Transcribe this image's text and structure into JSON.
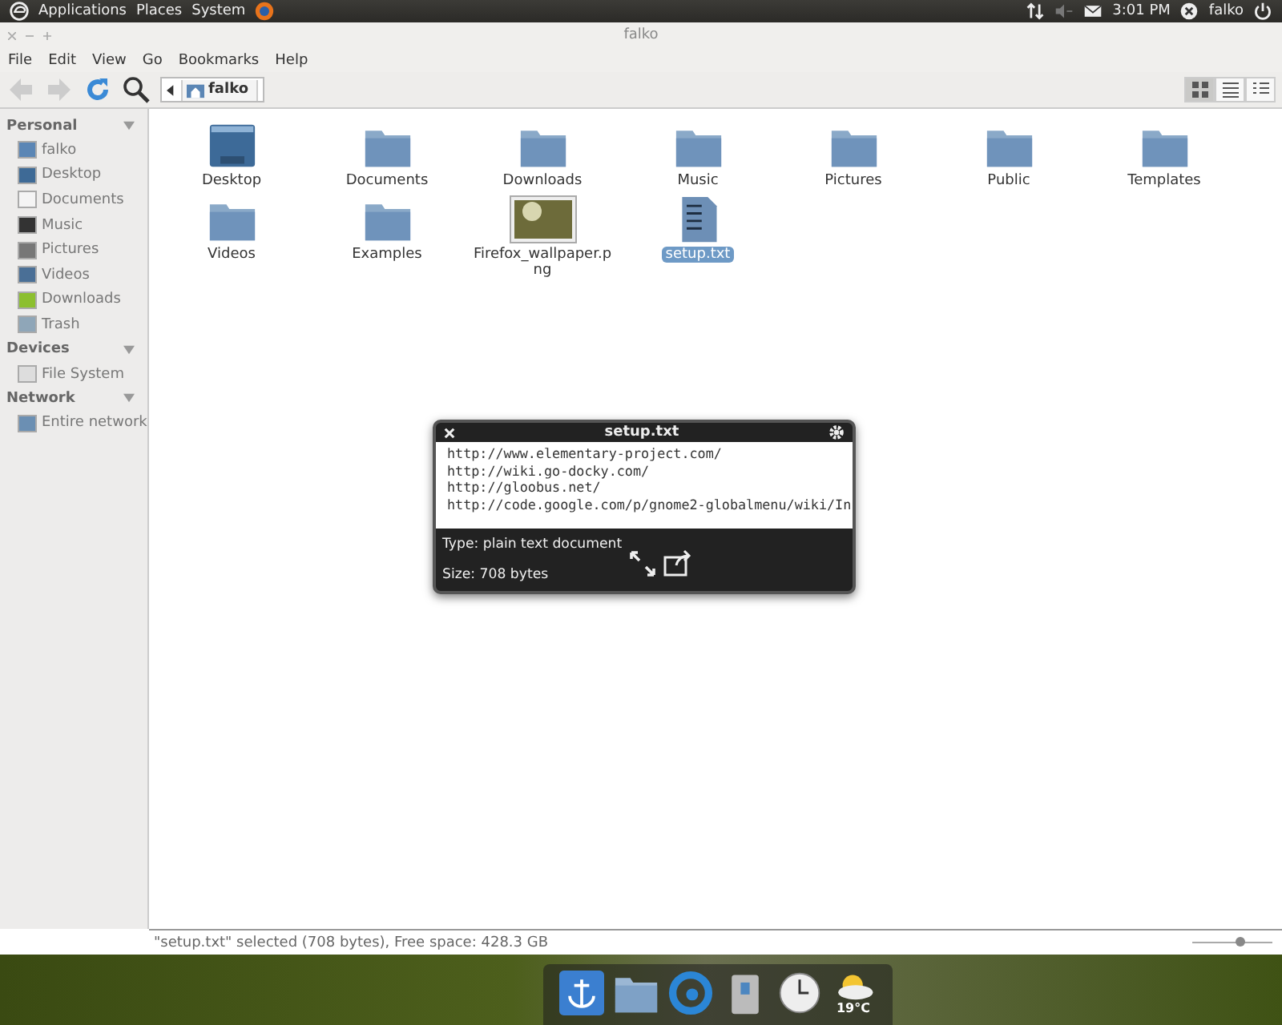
{
  "top_panel": {
    "menus": [
      "Applications",
      "Places",
      "System"
    ],
    "clock": "3:01 PM",
    "user": "falko"
  },
  "window": {
    "title": "falko"
  },
  "menu": [
    "File",
    "Edit",
    "View",
    "Go",
    "Bookmarks",
    "Help"
  ],
  "toolbar": {
    "location": "falko",
    "views": [
      {
        "kind": "icons",
        "selected": true
      },
      {
        "kind": "list",
        "selected": false
      },
      {
        "kind": "compact",
        "selected": false
      }
    ]
  },
  "sidebar": [
    {
      "heading": "Personal",
      "expanded": true,
      "items": [
        {
          "label": "falko",
          "kind": "home"
        },
        {
          "label": "Desktop",
          "kind": "desktop"
        },
        {
          "label": "Documents",
          "kind": "document"
        },
        {
          "label": "Music",
          "kind": "music"
        },
        {
          "label": "Pictures",
          "kind": "picture"
        },
        {
          "label": "Videos",
          "kind": "video"
        },
        {
          "label": "Downloads",
          "kind": "download"
        },
        {
          "label": "Trash",
          "kind": "trash"
        }
      ]
    },
    {
      "heading": "Devices",
      "expanded": true,
      "items": [
        {
          "label": "File System",
          "kind": "drive"
        }
      ]
    },
    {
      "heading": "Network",
      "expanded": true,
      "items": [
        {
          "label": "Entire network",
          "kind": "network"
        }
      ]
    }
  ],
  "files": [
    {
      "label": "Desktop",
      "kind": "desktop",
      "selected": false
    },
    {
      "label": "Documents",
      "kind": "folder",
      "selected": false
    },
    {
      "label": "Downloads",
      "kind": "folder",
      "selected": false
    },
    {
      "label": "Music",
      "kind": "folder",
      "selected": false
    },
    {
      "label": "Pictures",
      "kind": "folder",
      "selected": false
    },
    {
      "label": "Public",
      "kind": "folder",
      "selected": false
    },
    {
      "label": "Templates",
      "kind": "folder",
      "selected": false
    },
    {
      "label": "Videos",
      "kind": "folder",
      "selected": false
    },
    {
      "label": "Examples",
      "kind": "folder",
      "selected": false
    },
    {
      "label": "Firefox_wallpaper.png",
      "kind": "image",
      "selected": false
    },
    {
      "label": "setup.txt",
      "kind": "text",
      "selected": true
    }
  ],
  "preview": {
    "title": "setup.txt",
    "lines": [
      "http://www.elementary-project.com/",
      "http://wiki.go-docky.com/",
      "http://gloobus.net/",
      "http://code.google.com/p/gnome2-globalmenu/wiki/In"
    ],
    "type": "Type: plain text document",
    "size": "Size: 708 bytes"
  },
  "status_bar": {
    "text": "\"setup.txt\" selected (708 bytes), Free space: 428.3 GB",
    "zoom": {
      "level": 0.6
    }
  },
  "dock": {
    "weather": "19°C"
  }
}
